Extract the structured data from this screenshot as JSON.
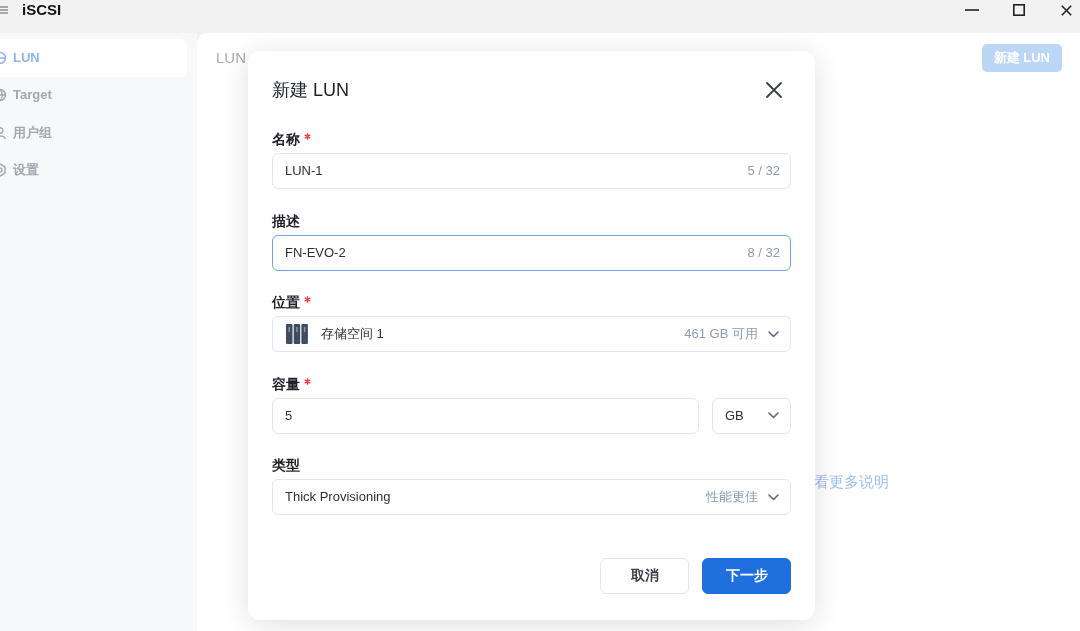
{
  "window": {
    "title": "iSCSI"
  },
  "sidebar": {
    "items": [
      {
        "label": "LUN",
        "selected": true
      },
      {
        "label": "Target",
        "selected": false
      },
      {
        "label": "用户组",
        "selected": false
      },
      {
        "label": "设置",
        "selected": false
      }
    ]
  },
  "main": {
    "heading": "LUN",
    "action_button": "新建 LUN",
    "help_link": "看更多说明"
  },
  "dialog": {
    "title": "新建 LUN",
    "fields": [
      {
        "kind": "text",
        "label": "名称",
        "required": true,
        "value": "LUN-1",
        "counter": "5 / 32",
        "focused": false
      },
      {
        "kind": "text",
        "label": "描述",
        "required": false,
        "value": "FN-EVO-2",
        "counter": "8 / 32",
        "focused": true
      },
      {
        "kind": "storage",
        "label": "位置",
        "required": true,
        "value": "存储空间 1",
        "hint": "461 GB 可用",
        "focused": false
      },
      {
        "kind": "size",
        "label": "容量",
        "required": true,
        "value": "5",
        "unit": "GB",
        "focused": false
      },
      {
        "kind": "select",
        "label": "类型",
        "required": false,
        "value": "Thick Provisioning",
        "hint": "性能更佳",
        "focused": false
      }
    ],
    "buttons": [
      {
        "label": "取消",
        "kind": "secondary"
      },
      {
        "label": "下一步",
        "kind": "primary"
      }
    ]
  }
}
